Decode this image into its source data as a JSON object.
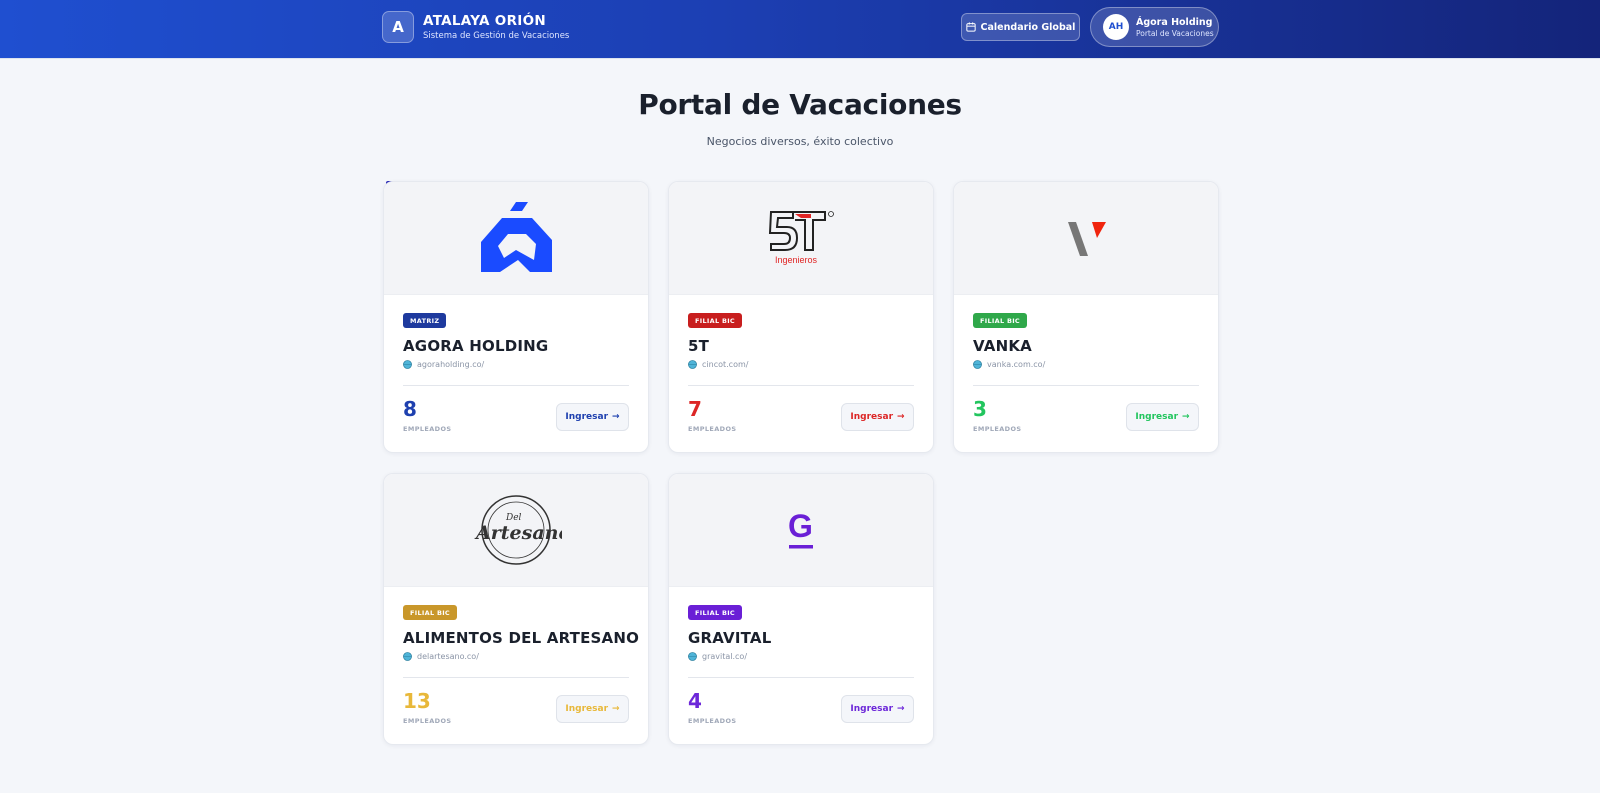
{
  "header": {
    "brand_initial": "A",
    "brand_title": "ATALAYA ORIÓN",
    "brand_subtitle": "Sistema de Gestión de Vacaciones",
    "calendar_button": "Calendario Global",
    "user": {
      "initials": "AH",
      "name": "Ágora Holding",
      "role": "Portal de Vacaciones"
    }
  },
  "hero": {
    "title": "Portal de Vacaciones",
    "subtitle": "Negocios diversos, éxito colectivo"
  },
  "companies": [
    {
      "badge": "MATRIZ",
      "name": "AGORA HOLDING",
      "site": "agoraholding.co/",
      "employees": "8",
      "employees_label": "EMPLEADOS",
      "enter_label": "Ingresar",
      "arrow": "→",
      "color": "#1e40af",
      "badge_color": "#1e3a9e",
      "logo": "agora-logo-icon"
    },
    {
      "badge": "FILIAL BIC",
      "name": "5T",
      "site": "cincot.com/",
      "employees": "7",
      "employees_label": "EMPLEADOS",
      "enter_label": "Ingresar",
      "arrow": "→",
      "color": "#dc2626",
      "badge_color": "#c81e1e",
      "logo": "5t-logo-icon",
      "logo_caption": "Ingenieros"
    },
    {
      "badge": "FILIAL BIC",
      "name": "VANKA",
      "site": "vanka.com.co/",
      "employees": "3",
      "employees_label": "EMPLEADOS",
      "enter_label": "Ingresar",
      "arrow": "→",
      "color": "#22c55e",
      "badge_color": "#2fa84a",
      "logo": "vanka-logo-icon"
    },
    {
      "badge": "FILIAL BIC",
      "name": "ALIMENTOS DEL ARTESANO",
      "site": "delartesano.co/",
      "employees": "13",
      "employees_label": "EMPLEADOS",
      "enter_label": "Ingresar",
      "arrow": "→",
      "color": "#e8b83a",
      "badge_color": "#c9972a",
      "logo": "artesano-logo-icon",
      "logo_caption": "Artesano",
      "logo_small": "Del"
    },
    {
      "badge": "FILIAL BIC",
      "name": "GRAVITAL",
      "site": "gravital.co/",
      "employees": "4",
      "employees_label": "EMPLEADOS",
      "enter_label": "Ingresar",
      "arrow": "→",
      "color": "#6d28d9",
      "badge_color": "#6a1fd6",
      "logo": "gravital-logo-icon",
      "logo_caption": "G"
    }
  ]
}
